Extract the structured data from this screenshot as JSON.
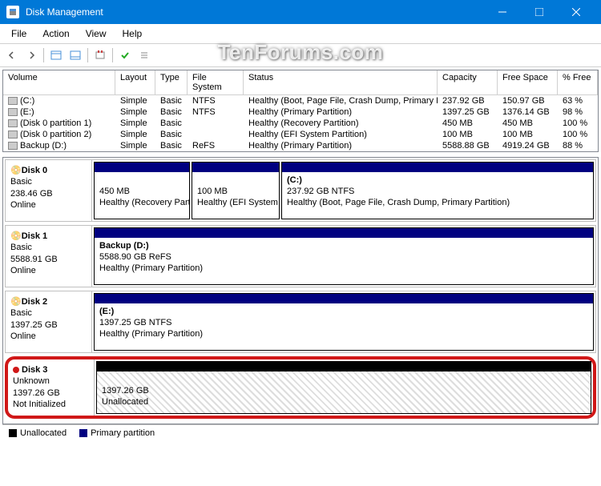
{
  "window": {
    "title": "Disk Management"
  },
  "menu": {
    "file": "File",
    "action": "Action",
    "view": "View",
    "help": "Help"
  },
  "watermark": "TenForums.com",
  "columns": {
    "volume": "Volume",
    "layout": "Layout",
    "type": "Type",
    "fs": "File System",
    "status": "Status",
    "capacity": "Capacity",
    "free": "Free Space",
    "pct": "% Free"
  },
  "volumes": [
    {
      "name": "(C:)",
      "layout": "Simple",
      "type": "Basic",
      "fs": "NTFS",
      "status": "Healthy (Boot, Page File, Crash Dump, Primary Partition)",
      "capacity": "237.92 GB",
      "free": "150.97 GB",
      "pct": "63 %"
    },
    {
      "name": "(E:)",
      "layout": "Simple",
      "type": "Basic",
      "fs": "NTFS",
      "status": "Healthy (Primary Partition)",
      "capacity": "1397.25 GB",
      "free": "1376.14 GB",
      "pct": "98 %"
    },
    {
      "name": "(Disk 0 partition 1)",
      "layout": "Simple",
      "type": "Basic",
      "fs": "",
      "status": "Healthy (Recovery Partition)",
      "capacity": "450 MB",
      "free": "450 MB",
      "pct": "100 %"
    },
    {
      "name": "(Disk 0 partition 2)",
      "layout": "Simple",
      "type": "Basic",
      "fs": "",
      "status": "Healthy (EFI System Partition)",
      "capacity": "100 MB",
      "free": "100 MB",
      "pct": "100 %"
    },
    {
      "name": "Backup (D:)",
      "layout": "Simple",
      "type": "Basic",
      "fs": "ReFS",
      "status": "Healthy (Primary Partition)",
      "capacity": "5588.88 GB",
      "free": "4919.24 GB",
      "pct": "88 %"
    }
  ],
  "disks": {
    "d0": {
      "name": "Disk 0",
      "type": "Basic",
      "size": "238.46 GB",
      "state": "Online",
      "p0": {
        "l1": "450 MB",
        "l2": "Healthy (Recovery Partition)"
      },
      "p1": {
        "l1": "100 MB",
        "l2": "Healthy (EFI System Partition)"
      },
      "p2": {
        "title": "(C:)",
        "l1": "237.92 GB NTFS",
        "l2": "Healthy (Boot, Page File, Crash Dump, Primary Partition)"
      }
    },
    "d1": {
      "name": "Disk 1",
      "type": "Basic",
      "size": "5588.91 GB",
      "state": "Online",
      "p0": {
        "title": "Backup  (D:)",
        "l1": "5588.90 GB ReFS",
        "l2": "Healthy (Primary Partition)"
      }
    },
    "d2": {
      "name": "Disk 2",
      "type": "Basic",
      "size": "1397.25 GB",
      "state": "Online",
      "p0": {
        "title": "(E:)",
        "l1": "1397.25 GB NTFS",
        "l2": "Healthy (Primary Partition)"
      }
    },
    "d3": {
      "name": "Disk 3",
      "type": "Unknown",
      "size": "1397.26 GB",
      "state": "Not Initialized",
      "p0": {
        "l1": "1397.26 GB",
        "l2": "Unallocated"
      }
    }
  },
  "legend": {
    "unalloc": "Unallocated",
    "primary": "Primary partition"
  }
}
